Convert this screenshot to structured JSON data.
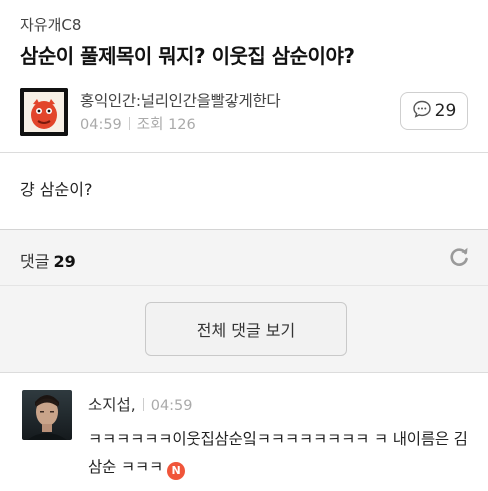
{
  "post": {
    "board": "자유개C8",
    "title": "삼순이 풀제목이 뭐지? 이웃집 삼순이야?",
    "author": "홍익인간:널리인간을빨갛게한다",
    "time": "04:59",
    "views": "조회 126",
    "comment_count": "29",
    "body": "걍 삼순이?"
  },
  "comments_section": {
    "label": "댓글",
    "count": "29",
    "view_all_label": "전체 댓글 보기"
  },
  "comments": [
    {
      "author": "소지섭,",
      "time": "04:59",
      "text": "ㅋㅋㅋㅋㅋㅋ이웃집삼순잌ㅋㅋㅋㅋㅋㅋㅋㅋ ㅋ 내이름은 김삼순 ㅋㅋㅋ",
      "badge": "N"
    }
  ],
  "colors": {
    "accent_badge": "#f0553a",
    "section_bg": "#f4f4f4"
  },
  "icons": {
    "comment": "speech-bubble-icon",
    "refresh": "refresh-icon"
  }
}
